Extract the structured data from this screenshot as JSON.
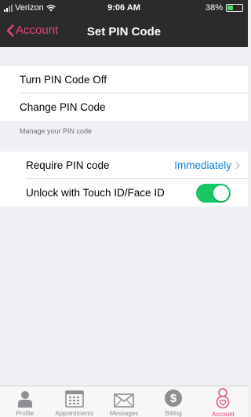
{
  "status_bar": {
    "carrier": "Verizon",
    "time": "9:06 AM",
    "battery": "38%",
    "battery_level": 0.38
  },
  "nav": {
    "back_label": "Account",
    "title": "Set PIN Code"
  },
  "pin_options": [
    {
      "label": "Turn PIN Code Off"
    },
    {
      "label": "Change PIN Code"
    }
  ],
  "section_footer": "Manage your PIN code",
  "settings": {
    "require_pin": {
      "label": "Require PIN code",
      "value": "Immediately"
    },
    "touch_id": {
      "label": "Unlock with Touch ID/Face ID",
      "enabled": true
    }
  },
  "tabs": [
    {
      "label": "Profile",
      "icon": "person-icon",
      "active": false
    },
    {
      "label": "Appointments",
      "icon": "calendar-icon",
      "active": false
    },
    {
      "label": "Messages",
      "icon": "envelope-icon",
      "active": false
    },
    {
      "label": "Billing",
      "icon": "dollar-icon",
      "active": false
    },
    {
      "label": "Account",
      "icon": "account-icon",
      "active": true
    }
  ],
  "colors": {
    "accent": "#e8457a",
    "link_blue": "#0b7fd7",
    "toggle_on": "#18c663",
    "bar_dark": "#2b2b2b",
    "background": "#efeff4"
  }
}
